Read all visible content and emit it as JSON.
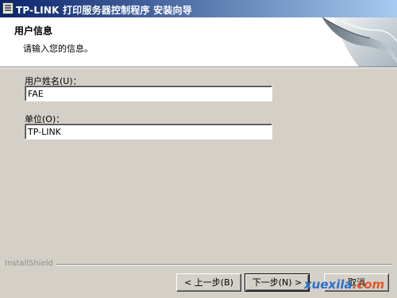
{
  "window": {
    "title": "TP-LINK 打印服务器控制程序 安装向导",
    "icon": "installer-icon"
  },
  "banner": {
    "heading": "用户信息",
    "subheading": "请输入您的信息。",
    "graphic": "page-curl-graphic"
  },
  "form": {
    "username_label": "用户姓名(U)：",
    "username_value": "FAE",
    "organization_label": "单位(O)：",
    "organization_value": "TP-LINK"
  },
  "footer": {
    "brand": "InstallShield"
  },
  "buttons": {
    "back": "< 上一步(B)",
    "next": "下一步(N) >",
    "cancel": "取消"
  },
  "watermark": {
    "name": "xuexila",
    "domain": ".com"
  }
}
